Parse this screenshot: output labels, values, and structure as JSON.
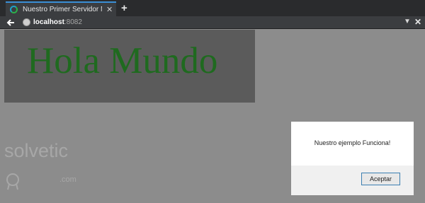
{
  "browser": {
    "tab": {
      "title": "Nuestro Primer Servidor N...",
      "close_glyph": "✕"
    },
    "new_tab_glyph": "+",
    "address": {
      "host": "localhost",
      "port": ":8082"
    },
    "dropdown_glyph": "▼",
    "close_glyph": "✕"
  },
  "page": {
    "heading": "Hola Mundo",
    "heading_color": "#1f6a1f"
  },
  "dialog": {
    "message": "Nuestro ejemplo Funciona!",
    "accept_label": "Aceptar",
    "accept_border": "#3c7fb1"
  },
  "watermark": {
    "brand": "solvetic",
    "suffix": ".com"
  },
  "icons": [
    "loading-spinner-icon",
    "new-tab-icon",
    "back-arrow-icon",
    "globe-icon",
    "dropdown-icon",
    "close-icon"
  ]
}
